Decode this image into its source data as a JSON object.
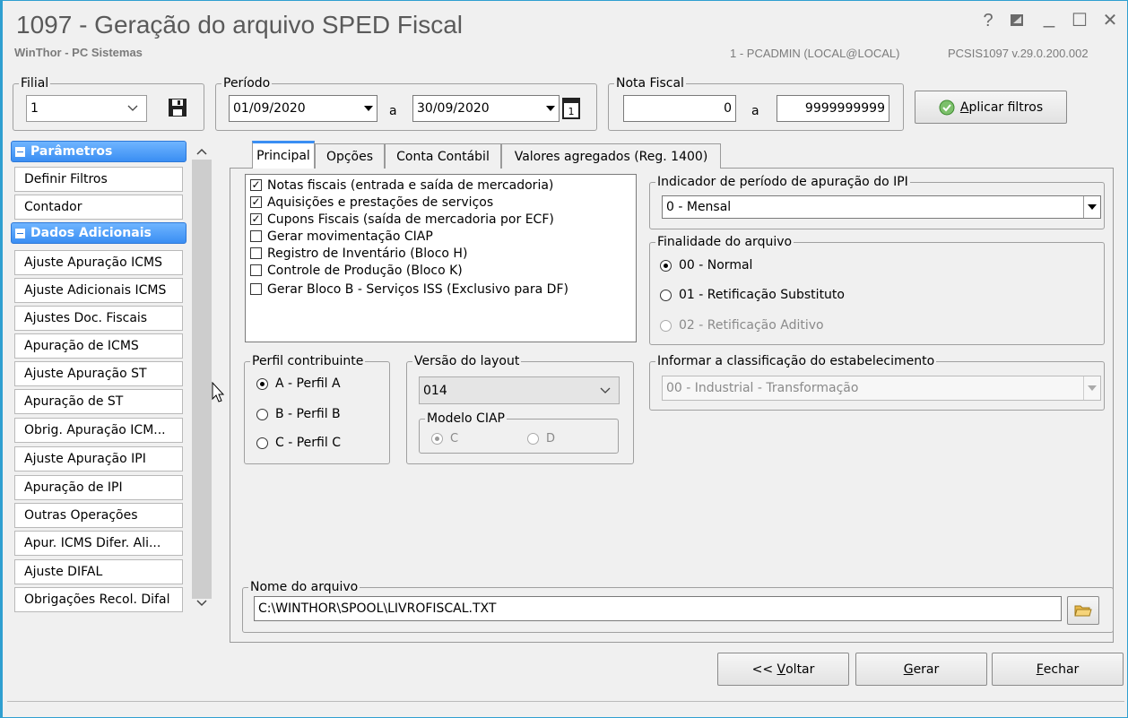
{
  "window": {
    "title": "1097 - Geração do arquivo SPED Fiscal",
    "app_name": "WinThor - PC Sistemas",
    "user_info": "1 - PCADMIN (LOCAL@LOCAL)",
    "program_info": "PCSIS1097  v.29.0.200.002",
    "help_label": "?",
    "minimize_label": "_",
    "maximize_label": "☐",
    "close_label": "✕"
  },
  "filters": {
    "filial_legend": "Filial",
    "filial_value": "1",
    "periodo_legend": "Período",
    "date_start": "01/09/2020",
    "date_sep": "a",
    "date_end": "30/09/2020",
    "nota_legend": "Nota Fiscal",
    "nota_start": "0",
    "nota_sep": "a",
    "nota_end": "9999999999",
    "apply_prefix": "A",
    "apply_rest": "plicar filtros"
  },
  "sidebar": {
    "section_params": "Parâmetros",
    "params_items": [
      "Definir Filtros",
      "Contador"
    ],
    "section_dados": "Dados Adicionais",
    "dados_items": [
      "Ajuste Apuração ICMS",
      "Ajuste Adicionais ICMS",
      "Ajustes Doc. Fiscais",
      "Apuração de ICMS",
      "Ajuste Apuração ST",
      "Apuração de ST",
      "Obrig. Apuração ICM...",
      "Ajuste Apuração IPI",
      "Apuração de IPI",
      "Outras Operações",
      "Apur. ICMS Difer. Ali...",
      "Ajuste DIFAL",
      "Obrigações Recol. Difal"
    ]
  },
  "tabs": [
    "Principal",
    "Opções",
    "Conta Contábil",
    "Valores agregados (Reg. 1400)"
  ],
  "options": [
    {
      "label": "Notas fiscais (entrada e saída de mercadoria)",
      "checked": true
    },
    {
      "label": "Aquisições e prestações de serviços",
      "checked": true
    },
    {
      "label": "Cupons Fiscais (saída de mercadoria por ECF)",
      "checked": true
    },
    {
      "label": "Gerar movimentação CIAP",
      "checked": false
    },
    {
      "label": "Registro de Inventário (Bloco H)",
      "checked": false
    },
    {
      "label": "Controle de Produção (Bloco K)",
      "checked": false
    },
    {
      "label": "Gerar Bloco B - Serviços ISS (Exclusivo para DF)",
      "checked": false
    }
  ],
  "ipi": {
    "legend": "Indicador de período de apuração do IPI",
    "value": "0 - Mensal"
  },
  "finalidade": {
    "legend": "Finalidade do arquivo",
    "options": [
      "00 - Normal",
      "01 - Retificação Substituto",
      "02 - Retificação Aditivo"
    ]
  },
  "perfil": {
    "legend": "Perfil contribuinte",
    "options": [
      "A - Perfil A",
      "B - Perfil B",
      "C - Perfil C"
    ]
  },
  "versao": {
    "legend": "Versão do layout",
    "value": "014"
  },
  "ciap": {
    "legend": "Modelo CIAP",
    "options": [
      "C",
      "D"
    ]
  },
  "classificacao": {
    "legend": "Informar a classificação do estabelecimento",
    "value": "00 - Industrial - Transformação"
  },
  "arquivo": {
    "legend": "Nome do arquivo",
    "value": "C:\\WINTHOR\\SPOOL\\LIVROFISCAL.TXT"
  },
  "buttons": {
    "voltar_prefix": "<< ",
    "voltar_u": "V",
    "voltar_rest": "oltar",
    "gerar_u": "G",
    "gerar_rest": "erar",
    "fechar_u": "F",
    "fechar_rest": "echar"
  }
}
